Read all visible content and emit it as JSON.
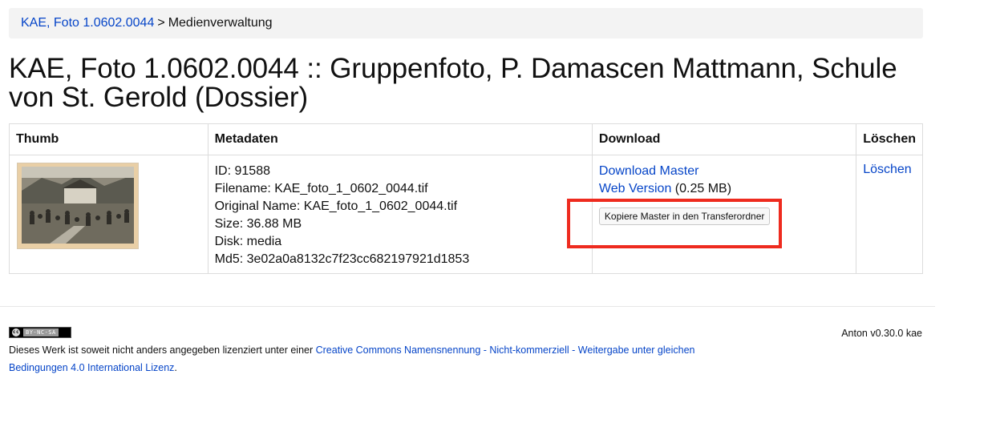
{
  "breadcrumb": {
    "link": "KAE, Foto 1.0602.0044",
    "separator": ">",
    "current": "Medienverwaltung"
  },
  "page_title": "KAE, Foto 1.0602.0044 :: Gruppenfoto, P. Damascen Mattmann, Schule von St. Gerold (Dossier)",
  "table": {
    "headers": {
      "thumb": "Thumb",
      "metadata": "Metadaten",
      "download": "Download",
      "delete": "Löschen"
    },
    "row": {
      "metadata": {
        "id": "ID: 91588",
        "filename": "Filename: KAE_foto_1_0602_0044.tif",
        "original_name": "Original Name: KAE_foto_1_0602_0044.tif",
        "size": "Size: 36.88 MB",
        "disk": "Disk: media",
        "md5": "Md5: 3e02a0a8132c7f23cc682197921d1853"
      },
      "download": {
        "master_link": "Download Master",
        "web_link": "Web Version",
        "web_size": " (0.25 MB)",
        "copy_button": "Kopiere Master in den Transferordner"
      },
      "delete_link": "Löschen"
    }
  },
  "footer": {
    "badge": {
      "circle": "cc",
      "text": "BY-NC-SA"
    },
    "license_prefix": "Dieses Werk ist soweit nicht anders angegeben lizenziert unter einer ",
    "license_link": "Creative Commons Namensnennung - Nicht-kommerziell - Weitergabe unter gleichen Bedingungen 4.0 International Lizenz",
    "license_suffix": ".",
    "version": "Anton v0.30.0 kae"
  },
  "colors": {
    "link": "#0645c8",
    "highlight": "#ee2b1f",
    "breadcrumb_bg": "#f3f3f3"
  }
}
